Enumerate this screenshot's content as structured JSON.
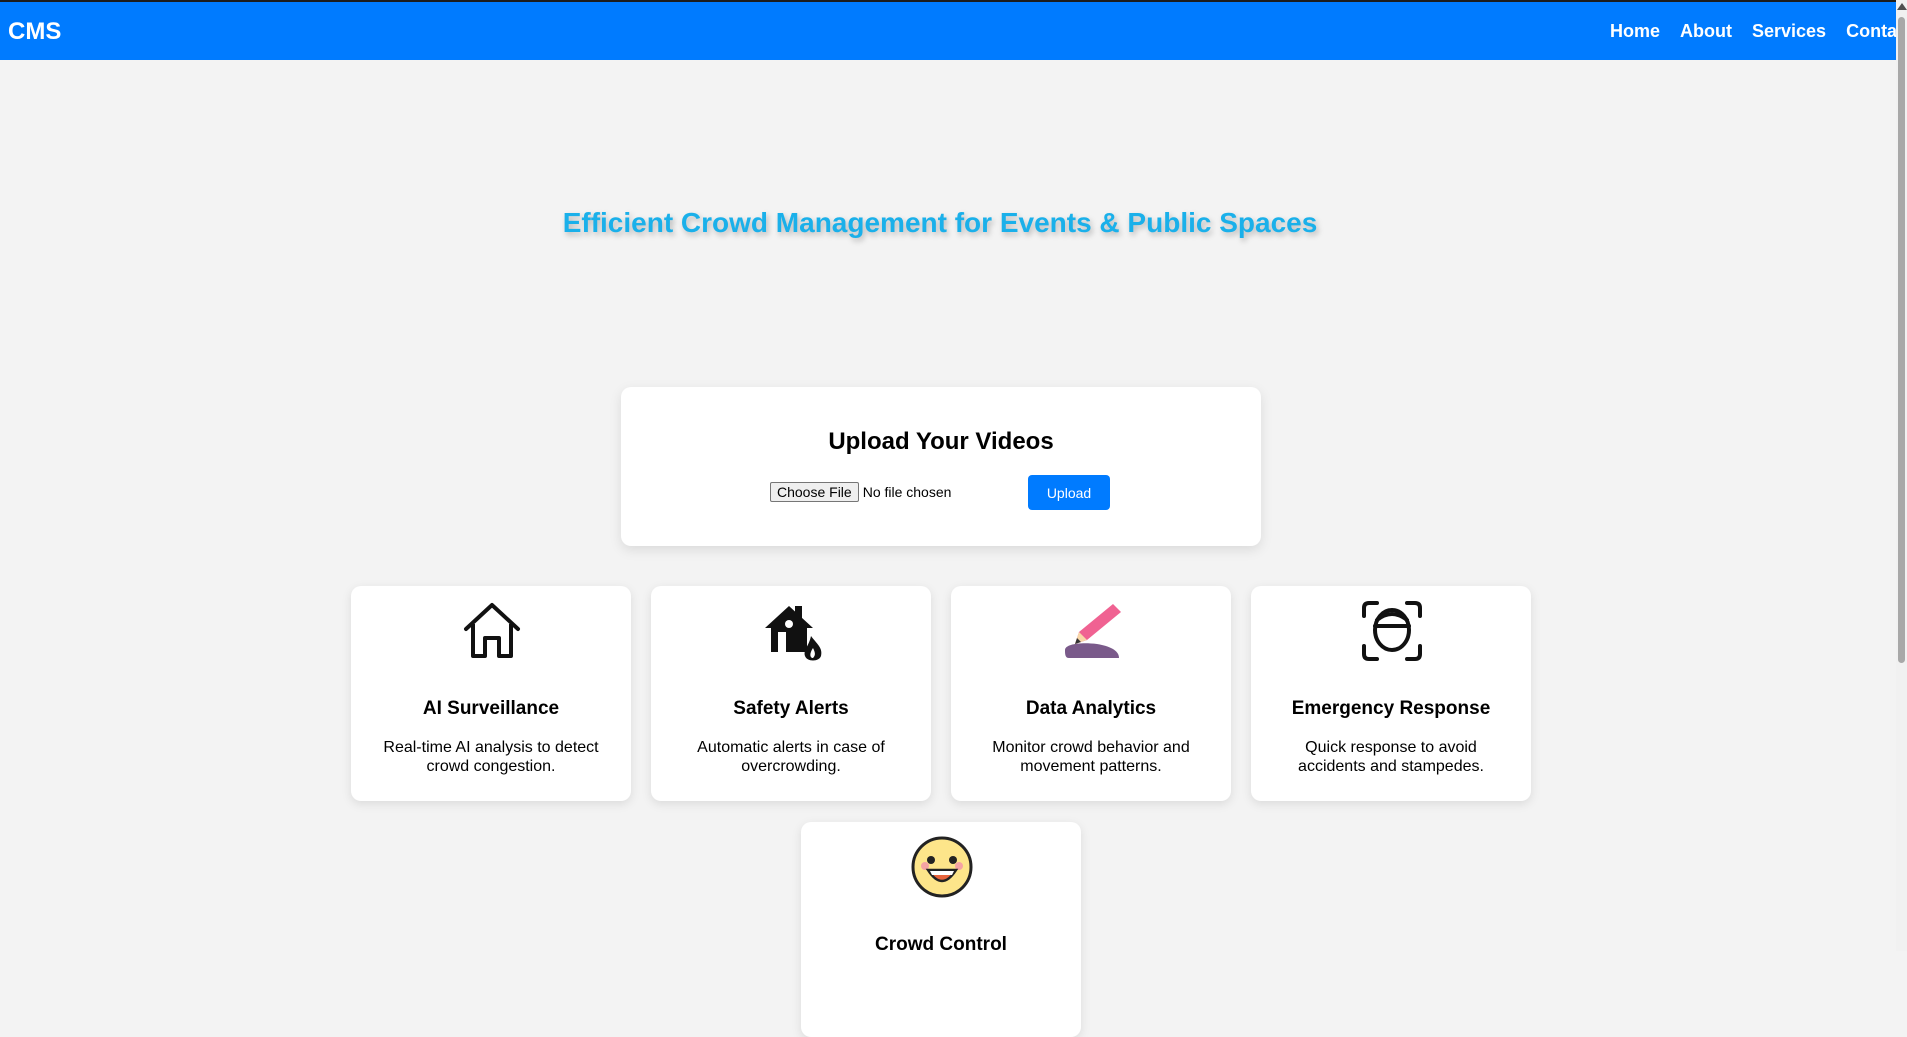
{
  "navbar": {
    "brand": "CMS",
    "links": [
      "Home",
      "About",
      "Services",
      "Contact"
    ],
    "color": "#007bff"
  },
  "hero": {
    "title": "Efficient Crowd Management for Events & Public Spaces",
    "color": "#1ab0ea"
  },
  "upload": {
    "title": "Upload Your Videos",
    "choose_label": "Choose File",
    "file_status": "No file chosen",
    "button_label": "Upload"
  },
  "features": [
    {
      "icon": "house-icon",
      "title": "AI Surveillance",
      "description": "Real-time AI analysis to detect crowd congestion."
    },
    {
      "icon": "house-fire-icon",
      "title": "Safety Alerts",
      "description": "Automatic alerts in case of overcrowding."
    },
    {
      "icon": "pencil-icon",
      "title": "Data Analytics",
      "description": "Monitor crowd behavior and movement patterns."
    },
    {
      "icon": "face-scan-icon",
      "title": "Emergency Response",
      "description": "Quick response to avoid accidents and stampedes."
    },
    {
      "icon": "smiley-icon",
      "title": "Crowd Control",
      "description": ""
    }
  ]
}
